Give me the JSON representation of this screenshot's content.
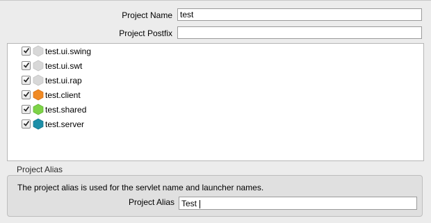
{
  "form": {
    "project_name_label": "Project Name",
    "project_name_value": "test",
    "project_postfix_label": "Project Postfix",
    "project_postfix_value": ""
  },
  "projects": [
    {
      "label": "test.ui.swing",
      "checked": true,
      "icon": "grey-hexagon-icon",
      "icon_color": "#d8d8d8"
    },
    {
      "label": "test.ui.swt",
      "checked": true,
      "icon": "grey-hexagon-icon",
      "icon_color": "#d8d8d8"
    },
    {
      "label": "test.ui.rap",
      "checked": true,
      "icon": "grey-hexagon-icon",
      "icon_color": "#d8d8d8"
    },
    {
      "label": "test.client",
      "checked": true,
      "icon": "orange-hexagon-icon",
      "icon_color": "#f08a24"
    },
    {
      "label": "test.shared",
      "checked": true,
      "icon": "green-hexagon-icon",
      "icon_color": "#7ed348"
    },
    {
      "label": "test.server",
      "checked": true,
      "icon": "teal-hexagon-icon",
      "icon_color": "#1d8fa8"
    }
  ],
  "alias_group": {
    "title": "Project Alias",
    "description": "The project alias is used for the servlet name and launcher names.",
    "alias_label": "Project Alias",
    "alias_value": "Test"
  }
}
